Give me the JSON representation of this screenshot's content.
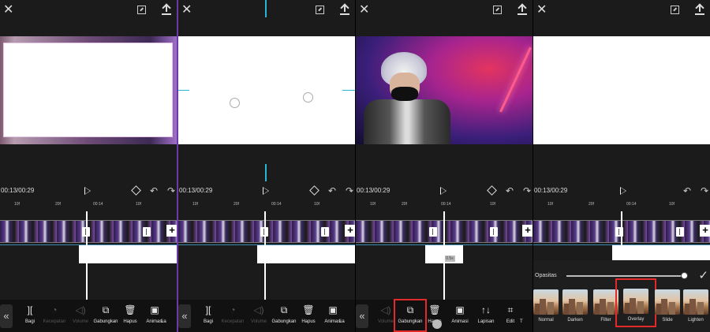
{
  "timecode": "00:13/00:29",
  "ruler": {
    "p1": [
      "10f",
      "20f",
      "00:14",
      "10f"
    ],
    "p2": [
      "10f",
      "20f",
      "00:14",
      "10f"
    ],
    "p3": [
      "10f",
      "20f",
      "00:14",
      "10f"
    ],
    "p4": [
      "10f",
      "20f",
      "00:14",
      "10f"
    ]
  },
  "toolbar_left": {
    "back": "«",
    "bagi": "Bagi",
    "kecepatan": "Kecepatan",
    "volume": "Volume",
    "gabungkan": "Gabungkan",
    "hapus": "Hapus",
    "animasi": "Animasi",
    "la": "La"
  },
  "toolbar_p3": {
    "back": "«",
    "volume": "Volume",
    "gabungkan": "Gabungkan",
    "hapus": "Hapus",
    "animasi": "Animasi",
    "lapisan": "Lapisan",
    "edit": "Edit",
    "t": "T"
  },
  "tooltip_p3": "0.5s",
  "opacity_panel": {
    "label": "Opasitas",
    "value_percent": 100,
    "modes": [
      "Normal",
      "Darken",
      "Filter",
      "Overlay",
      "Slide",
      "Lighten"
    ],
    "selected": "Overlay"
  },
  "colors": {
    "highlight": "#e32a2a",
    "guide": "#28b5d6",
    "divider": "#6b3aa8"
  }
}
